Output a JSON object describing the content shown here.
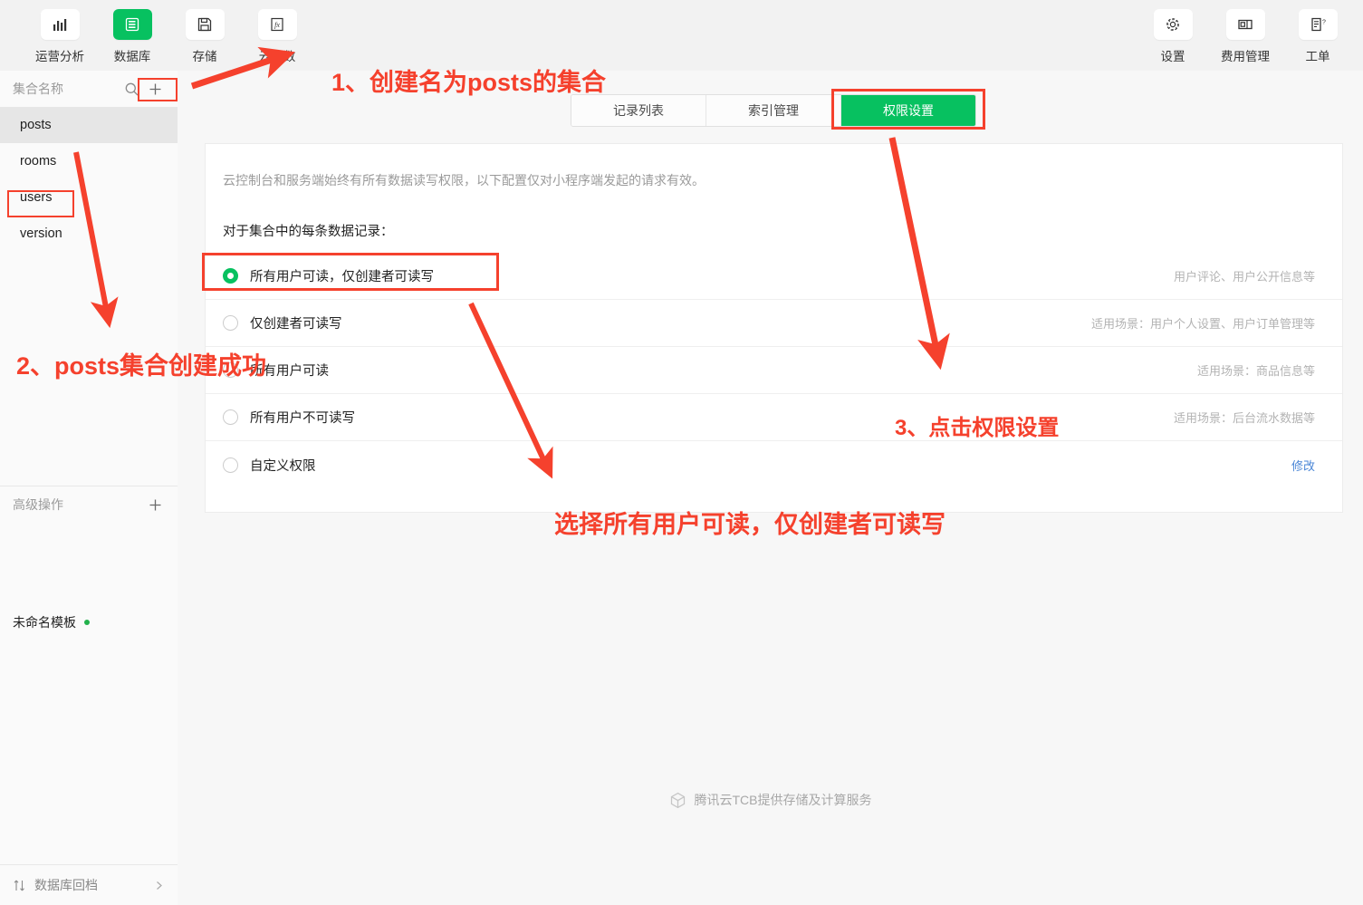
{
  "toolbar": {
    "left_items": [
      {
        "label": "运营分析",
        "icon": "bar-chart-icon",
        "active": false
      },
      {
        "label": "数据库",
        "icon": "database-icon",
        "active": true
      },
      {
        "label": "存储",
        "icon": "floppy-disk-icon",
        "active": false
      },
      {
        "label": "云函数",
        "icon": "fx-function-icon",
        "active": false
      }
    ],
    "right_items": [
      {
        "label": "设置",
        "icon": "gear-icon"
      },
      {
        "label": "费用管理",
        "icon": "billing-card-icon"
      },
      {
        "label": "工单",
        "icon": "ticket-icon"
      }
    ]
  },
  "sidebar": {
    "header_title": "集合名称",
    "search_icon": "search-icon",
    "add_icon": "plus-icon",
    "collections": [
      {
        "name": "posts",
        "selected": true
      },
      {
        "name": "rooms",
        "selected": false
      },
      {
        "name": "users",
        "selected": false
      },
      {
        "name": "version",
        "selected": false
      }
    ],
    "advanced_title": "高级操作",
    "advanced_add_icon": "plus-icon",
    "advanced_item": "未命名模板",
    "footer_label": "数据库回档",
    "footer_icon": "sort-updown-icon",
    "footer_chevron": "chevron-right-icon"
  },
  "main": {
    "tabs": [
      {
        "label": "记录列表",
        "active": false
      },
      {
        "label": "索引管理",
        "active": false
      },
      {
        "label": "权限设置",
        "active": true
      }
    ],
    "panel": {
      "description": "云控制台和服务端始终有所有数据读写权限，以下配置仅对小程序端发起的请求有效。",
      "subtitle": "对于集合中的每条数据记录：",
      "options": [
        {
          "label": "所有用户可读，仅创建者可读写",
          "hint": "用户评论、用户公开信息等",
          "checked": true,
          "hint_is_link": false
        },
        {
          "label": "仅创建者可读写",
          "hint": "适用场景：用户个人设置、用户订单管理等",
          "checked": false,
          "hint_is_link": false
        },
        {
          "label": "所有用户可读",
          "hint": "适用场景：商品信息等",
          "checked": false,
          "hint_is_link": false
        },
        {
          "label": "所有用户不可读写",
          "hint": "适用场景：后台流水数据等",
          "checked": false,
          "hint_is_link": false
        },
        {
          "label": "自定义权限",
          "hint": "修改",
          "checked": false,
          "hint_is_link": true
        }
      ]
    },
    "footer_brand": "腾讯云TCB提供存储及计算服务",
    "footer_brand_icon": "cube-logo-icon"
  },
  "annotations": {
    "step1": "1、创建名为posts的集合",
    "step2": "2、posts集合创建成功",
    "step3": "3、点击权限设置",
    "step4": "选择所有用户可读，仅创建者可读写"
  },
  "colors": {
    "brand_green": "#07c160",
    "annotation_red": "#f5412d",
    "link_blue": "#4a86d6",
    "page_bg": "#f7f7f7",
    "toolbar_bg": "#f2f2f2"
  }
}
